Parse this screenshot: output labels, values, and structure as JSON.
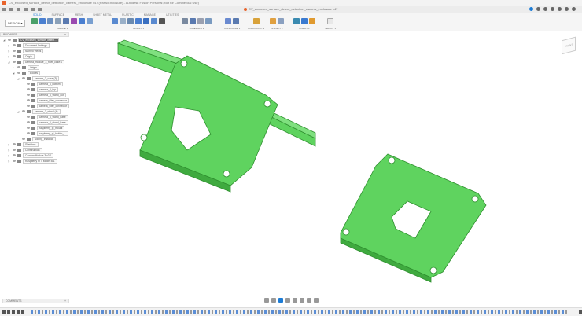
{
  "window": {
    "title": "CV_enclosed_surface_detect_detection_camera_enclosure v47 (Parts/Enclosure) - Autodesk Fusion Personal (Not for Commercial Use)",
    "doc_tab": "CV_enclosed_surface_detect_detection_camera_enclosure v47"
  },
  "toolbar": {
    "workspace": "DESIGN ▾",
    "tabs": [
      "SOLID",
      "SURFACE",
      "MESH",
      "SHEET METAL",
      "PLASTIC",
      "MANAGE",
      "UTILITIES"
    ],
    "groups": [
      "CREATE ▾",
      "MODIFY ▾",
      "ASSEMBLE ▾",
      "CONFIGURE ▾",
      "CONSTRUCT ▾",
      "INSPECT ▾",
      "INSERT ▾",
      "SELECT ▾"
    ]
  },
  "browser": {
    "title": "BROWSER",
    "nodes": [
      "CV_enclosed_surface_detect...",
      "Document Settings",
      "Named Views",
      "Origin",
      "camera_module_3_filter_case:1",
      "Origin",
      "Bodies",
      "camera_3_case (3)",
      "camera_3_bottom",
      "camera_3_top",
      "camera_3_stand_cut",
      "camera_filter_connector",
      "camera_filter_connector",
      "camera_3_stand (4)",
      "camera_3_stand_base",
      "camera_3_stand_base",
      "raspberry_pi_mount",
      "raspberry_pi_holder_...",
      "Sliding_Instance",
      "Sketches",
      "Construction",
      "Camera Module 3 v3:1",
      "Raspberry Pi 4 Model B:1"
    ]
  },
  "comments": {
    "label": "COMMENTS"
  },
  "viewcube": {
    "label": "FRONT"
  },
  "colors": {
    "accent": "#1c7cd6",
    "body": "#5fd35f",
    "body_edge": "#2f8f2f"
  }
}
